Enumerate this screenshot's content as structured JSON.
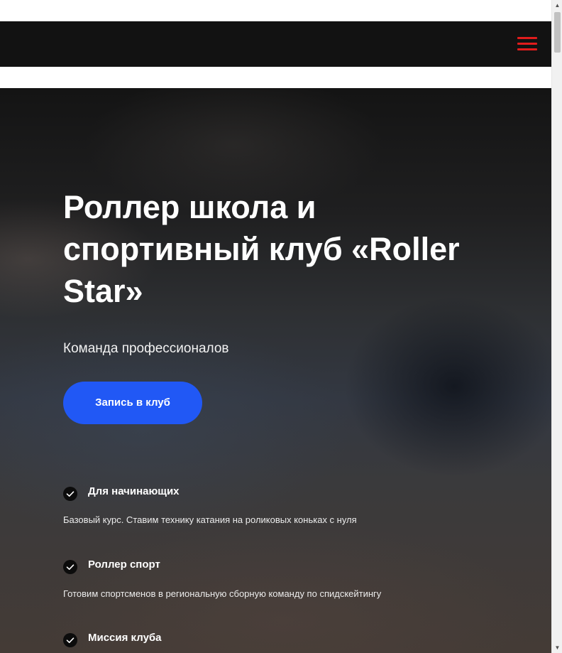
{
  "header": {
    "menu_icon": "hamburger-menu-icon",
    "menu_color": "#e01c1c",
    "background": "#121212"
  },
  "hero": {
    "title": "Роллер школа и спортивный клуб «Roller Star»",
    "subtitle": "Команда профессионалов",
    "cta_label": "Запись в клуб",
    "cta_color": "#2158f5"
  },
  "features": [
    {
      "icon": "check-circle-icon",
      "title": "Для начинающих",
      "description": "Базовый курс. Ставим технику катания на роликовых коньках с нуля"
    },
    {
      "icon": "check-circle-icon",
      "title": "Роллер спорт",
      "description": "Готовим спортсменов в региональную сборную команду по спидскейтингу"
    },
    {
      "icon": "check-circle-icon",
      "title": "Миссия клуба",
      "description": ""
    }
  ]
}
